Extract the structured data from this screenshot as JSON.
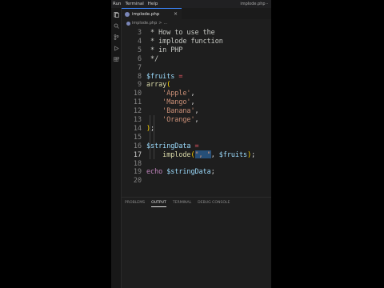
{
  "menu": [
    "Run",
    "Terminal",
    "Help"
  ],
  "window_title": "implode.php -",
  "tab": {
    "label": "implode.php",
    "close": "×"
  },
  "breadcrumb": {
    "file": "implode.php",
    "sep": ">",
    "more": "..."
  },
  "editor": {
    "lines": [
      {
        "n": "3",
        "tokens": [
          {
            "t": " * How to use the",
            "c": "c-com"
          }
        ]
      },
      {
        "n": "4",
        "tokens": [
          {
            "t": " * implode function",
            "c": "c-com"
          }
        ]
      },
      {
        "n": "5",
        "tokens": [
          {
            "t": " * in PHP",
            "c": "c-com"
          }
        ]
      },
      {
        "n": "6",
        "tokens": [
          {
            "t": " */",
            "c": "c-com"
          }
        ]
      },
      {
        "n": "7",
        "tokens": []
      },
      {
        "n": "8",
        "tokens": [
          {
            "t": "$fruits",
            "c": "c-var"
          },
          {
            "t": " ",
            "c": ""
          },
          {
            "t": "=",
            "c": "c-eq"
          }
        ]
      },
      {
        "n": "9",
        "tokens": [
          {
            "t": "array",
            "c": "c-fn"
          },
          {
            "t": "(",
            "c": "c-bracket"
          }
        ]
      },
      {
        "n": "10",
        "tokens": [
          {
            "t": "    ",
            "c": ""
          },
          {
            "t": "'Apple'",
            "c": "c-str"
          },
          {
            "t": ",",
            "c": "c-op"
          }
        ]
      },
      {
        "n": "11",
        "tokens": [
          {
            "t": "    ",
            "c": ""
          },
          {
            "t": "'Mango'",
            "c": "c-str"
          },
          {
            "t": ",",
            "c": "c-op"
          }
        ]
      },
      {
        "n": "12",
        "tokens": [
          {
            "t": "    ",
            "c": ""
          },
          {
            "t": "'Banana'",
            "c": "c-str"
          },
          {
            "t": ",",
            "c": "c-op"
          }
        ]
      },
      {
        "n": "13",
        "tokens": [
          {
            "t": "    ",
            "c": ""
          },
          {
            "t": "'Orange'",
            "c": "c-str"
          },
          {
            "t": ",",
            "c": "c-op"
          }
        ]
      },
      {
        "n": "14",
        "tokens": [
          {
            "t": ")",
            "c": "c-bracket"
          },
          {
            "t": ";",
            "c": "c-op"
          }
        ]
      },
      {
        "n": "15",
        "tokens": []
      },
      {
        "n": "16",
        "tokens": [
          {
            "t": "$stringData",
            "c": "c-var"
          },
          {
            "t": " ",
            "c": ""
          },
          {
            "t": "=",
            "c": "c-eq"
          }
        ]
      },
      {
        "n": "17",
        "active": true,
        "tokens": [
          {
            "t": "    ",
            "c": ""
          },
          {
            "t": "implode",
            "c": "c-fn"
          },
          {
            "t": "(",
            "c": "c-bracket"
          },
          {
            "t": "\", \"",
            "c": "c-str c-highlight"
          },
          {
            "t": ", ",
            "c": "c-op"
          },
          {
            "t": "$fruits",
            "c": "c-var"
          },
          {
            "t": ")",
            "c": "c-bracket"
          },
          {
            "t": ";",
            "c": "c-op"
          }
        ]
      },
      {
        "n": "18",
        "tokens": []
      },
      {
        "n": "19",
        "tokens": [
          {
            "t": "echo",
            "c": "c-kw"
          },
          {
            "t": " ",
            "c": ""
          },
          {
            "t": "$stringData",
            "c": "c-var"
          },
          {
            "t": ";",
            "c": "c-op"
          }
        ]
      },
      {
        "n": "20",
        "tokens": []
      }
    ]
  },
  "panel": {
    "tabs": [
      {
        "label": "PROBLEMS",
        "active": false
      },
      {
        "label": "OUTPUT",
        "active": true
      },
      {
        "label": "TERMINAL",
        "active": false
      },
      {
        "label": "DEBUG CONSOLE",
        "active": false
      }
    ]
  },
  "colors": {
    "accent": "#3b82f6",
    "background": "#1e1e1e"
  },
  "icons": [
    "files-icon",
    "search-icon",
    "source-control-icon",
    "run-debug-icon",
    "extensions-icon"
  ]
}
